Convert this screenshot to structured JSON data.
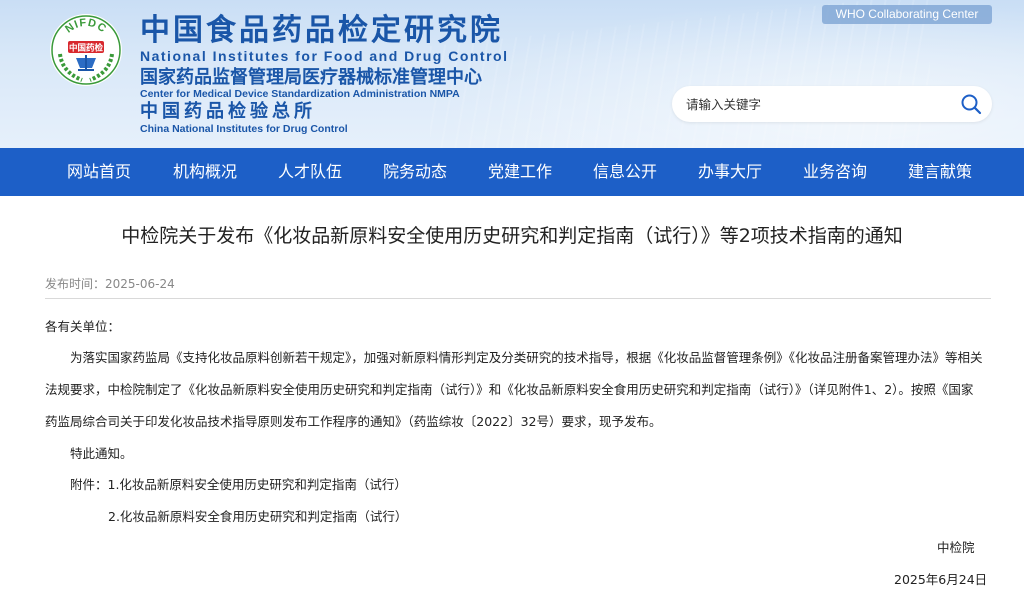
{
  "header": {
    "logo": {
      "arc_text": "NIFDC",
      "center_text": "中国药检"
    },
    "cn_title": "中国食品药品检定研究院",
    "en_title": "National Institutes for Food and Drug Control",
    "cn_sub": "国家药品监督管理局医疗器械标准管理中心",
    "en_sub": "Center for Medical Device Standardization Administration NMPA",
    "cn_sub2": "中国药品检验总所",
    "en_sub2": "China National Institutes for Drug Control",
    "who_badge": "WHO Collaborating Center",
    "search": {
      "placeholder": "请输入关键字",
      "value": ""
    }
  },
  "nav": {
    "items": [
      "网站首页",
      "机构概况",
      "人才队伍",
      "院务动态",
      "党建工作",
      "信息公开",
      "办事大厅",
      "业务咨询",
      "建言献策"
    ]
  },
  "article": {
    "title": "中检院关于发布《化妆品新原料安全使用历史研究和判定指南（试行）》等2项技术指南的通知",
    "meta": "发布时间：2025-06-24",
    "salutation": "各有关单位：",
    "para_lines": [
      "为落实国家药监局《支持化妆品原料创新若干规定》，加强对新原料情形判定及分类研究的技术指导，根据《化妆品监督管理条例》《化妆品注册备案管理办法》等相关",
      "法规要求，中检院制定了《化妆品新原料安全使用历史研究和判定指南（试行）》和《化妆品新原料安全食用历史研究和判定指南（试行）》（详见附件1、2）。按照《国家",
      "药监局综合司关于印发化妆品技术指导原则发布工作程序的通知》（药监综妆〔2022〕32号）要求，现予发布。"
    ],
    "notice": "特此通知。",
    "attachment_1": "附件：1.化妆品新原料安全使用历史研究和判定指南（试行）",
    "attachment_2": "2.化妆品新原料安全食用历史研究和判定指南（试行）",
    "signer": "中检院",
    "date": "2025年6月24日"
  },
  "colors": {
    "brand_blue": "#1a56a8",
    "nav_blue": "#1d5fc7",
    "logo_green": "#3a9a3a",
    "logo_red": "#d8282e"
  }
}
